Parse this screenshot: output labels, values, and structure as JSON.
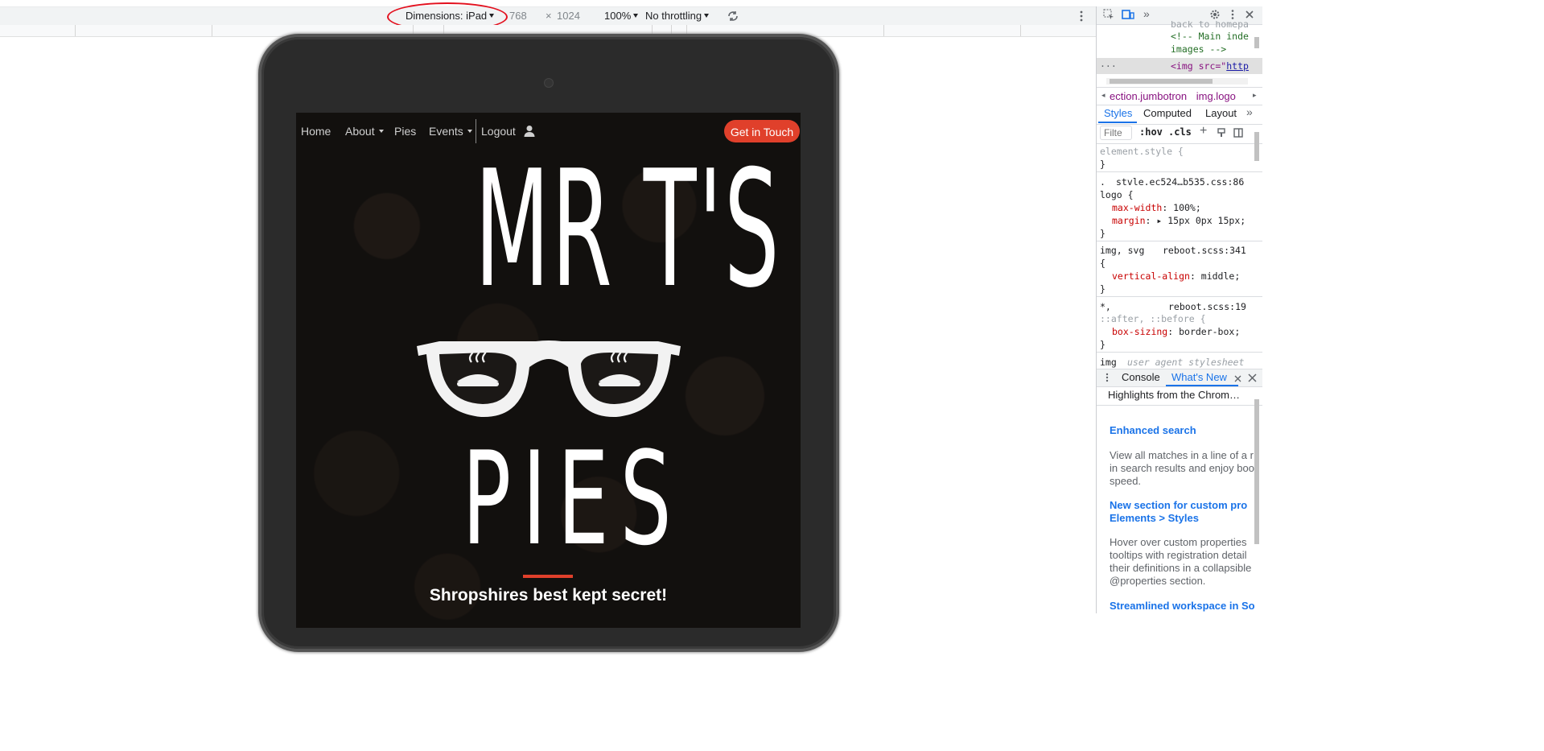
{
  "device_toolbar": {
    "dimensions_label": "Dimensions: iPad",
    "width": "768",
    "times": "×",
    "height": "1024",
    "zoom": "100%",
    "throttling": "No throttling",
    "rotate_icon": "rotate-icon",
    "more_icon": "more-vertical-icon"
  },
  "site": {
    "nav": {
      "home": "Home",
      "about": "About",
      "pies": "Pies",
      "events": "Events",
      "logout": "Logout",
      "user_icon": "user-icon",
      "cta": "Get in Touch"
    },
    "logo": {
      "line1": "MR T'S",
      "line2_icon": "glasses-with-pies-icon",
      "line3": "PIES"
    },
    "tagline": "Shropshires best kept secret!"
  },
  "devtools": {
    "top_icons": [
      "inspect-icon",
      "device-toggle-icon",
      "more-tabs-icon",
      "settings-icon",
      "more-vertical-icon",
      "close-icon"
    ],
    "source": {
      "line0": "back to homepa",
      "line1": "<!-- Main inde",
      "line2": "images -->",
      "line3_tag": "<img src=\"",
      "line3_link": "http",
      "ellipsis": "..."
    },
    "breadcrumb": [
      "ection.jumbotron",
      "img.logo"
    ],
    "tabs": {
      "styles": "Styles",
      "computed": "Computed",
      "layout": "Layout",
      "more": "»"
    },
    "filter": {
      "placeholder": "Filte",
      "hov": ":hov",
      ".cls": ".cls"
    },
    "rules": {
      "element_style": "element.style {",
      "close": "}",
      "rule1_selector_a": ".",
      "rule1_file": "stvle.ec524…b535.css:86",
      "rule1_selector_b": "logo {",
      "rule1_prop1": "max-width",
      "rule1_val1": ": 100%;",
      "rule1_prop2": "margin",
      "rule1_val2": ": ▸ 15px 0px 15px;",
      "rule2_selector": "img, svg",
      "rule2_file": "reboot.scss:341",
      "rule2_open": "{",
      "rule2_prop": "vertical-align",
      "rule2_val": ": middle;",
      "rule3_selector": "*,",
      "rule3_file": "reboot.scss:19",
      "rule3_selector_b": "::after, ::before {",
      "rule3_prop": "box-sizing",
      "rule3_val": ": border-box;",
      "rule4_selector": "img",
      "rule4_file": "user agent stylesheet"
    },
    "drawer": {
      "console": "Console",
      "whats_new": "What's New",
      "highlights": "Highlights from the Chrom…",
      "items": [
        {
          "title": "Enhanced search",
          "body": [
            "View all matches in a line of a r",
            "in search results and enjoy boo",
            "speed."
          ]
        },
        {
          "title": "New section for custom pro",
          "title2": "Elements > Styles",
          "body": [
            "Hover over custom properties",
            "tooltips with registration detail",
            "their definitions in a collapsible",
            "@properties section."
          ]
        },
        {
          "title": "Streamlined workspace in So"
        }
      ]
    }
  },
  "colors": {
    "accent": "#e0402b",
    "annotation_red": "#e3101e",
    "devtools_blue": "#1a73e8"
  }
}
